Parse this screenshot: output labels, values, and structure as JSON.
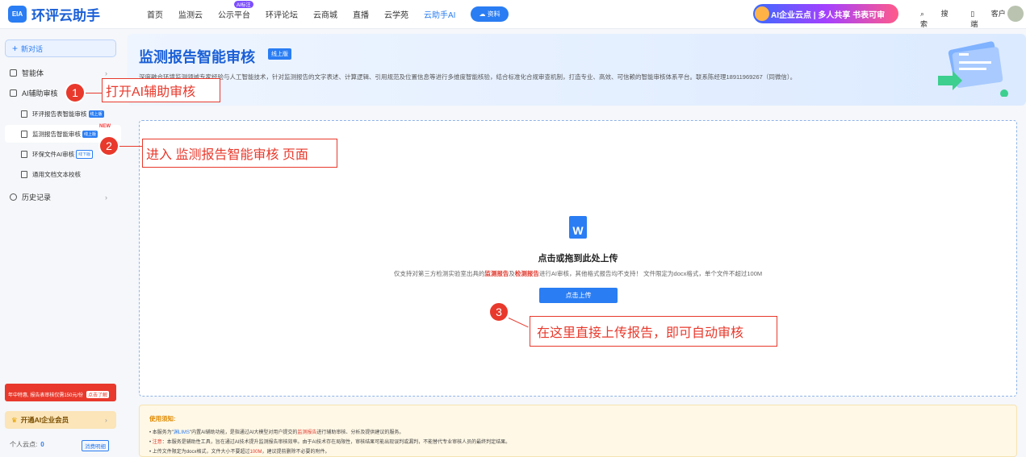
{
  "header": {
    "logo_mark": "EIA",
    "logo_text": "环评云助手",
    "nav": [
      "首页",
      "监测云",
      "公示平台",
      "环评论坛",
      "云商城",
      "直播",
      "云学苑",
      "云助手AI"
    ],
    "nav_badge": "AI标注",
    "pill": "资料",
    "ad_text": "AI企业云点 | 多人共享 书表可审",
    "search": "搜索",
    "client": "客户端"
  },
  "sidebar": {
    "new_chat": "新对话",
    "items": [
      "智能体",
      "AI辅助审核",
      "历史记录"
    ],
    "sub_items": [
      {
        "label": "环评报告表智能审核",
        "tag": "线上版"
      },
      {
        "label": "监测报告智能审核",
        "tag": "线上版",
        "new": "NEW"
      },
      {
        "label": "环保文件AI审核",
        "tag": "线下版"
      },
      {
        "label": "通用文档文本校核",
        "tag": ""
      }
    ],
    "promo": "年中特惠, 报告表审核仅需150元/份",
    "promo_btn": "点击了解",
    "vip": "开通AI企业会员",
    "points_label": "个人云点:",
    "points_value": "0",
    "points_btn": "消费明细"
  },
  "main": {
    "title": "监测报告智能审核",
    "online_tag": "线上版",
    "desc": "深度融合环境监测领域专家经验与人工智能技术，针对监测报告的文字表述、计算逻辑、引用规范及位置信息等进行多维度智能核验，结合标准化合规审查机制，打造专业、高效、可信赖的智能审核体系平台。联系陈经理18911969267（同微信）。",
    "upload_title": "点击或拖到此处上传",
    "upload_desc_1": "仅支持对第三方检测实验室出具的",
    "upload_desc_red1": "监测报告",
    "upload_desc_2": "及",
    "upload_desc_red2": "检测报告",
    "upload_desc_3": "进行AI审核，其他格式报告均不支持！ 文件限定为docx格式，单个文件不超过100M",
    "upload_btn": "点击上传",
    "notice_title": "使用须知:",
    "notice_1a": "本服务为\"",
    "notice_1b": "渊LIMS",
    "notice_1c": "\"内置AI辅助功能，是指通过AI大模型对用户提交的",
    "notice_1d": "监测报告",
    "notice_1e": "进行辅助审核、分析及提供建议的服务。",
    "notice_2a": "注意",
    "notice_2b": "：本服务是辅助性工具，旨在通过AI技术提升监测报告审核效率。由于AI技术存在局限性，审核结果可能出现误判或漏判，不能替代专业审核人员的最终判定结果。",
    "notice_3a": "上传文件限定为docx格式，文件大小不要超过",
    "notice_3b": "100M",
    "notice_3c": "，建议提前删除不必要的附件。"
  },
  "callouts": [
    {
      "num": "1",
      "text": "打开AI辅助审核"
    },
    {
      "num": "2",
      "text": "进入 监测报告智能审核 页面"
    },
    {
      "num": "3",
      "text": "在这里直接上传报告，即可自动审核"
    }
  ],
  "colors": {
    "accent": "#2a7df3",
    "callout": "#e8392c"
  }
}
